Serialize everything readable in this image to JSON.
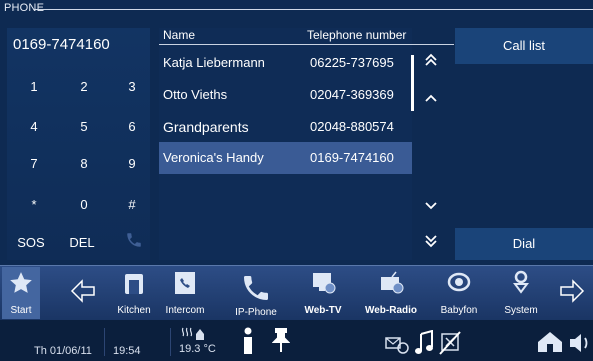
{
  "screen": {
    "title": "PHONE"
  },
  "keypad": {
    "number": "0169-7474160",
    "keys": [
      "1",
      "2",
      "3",
      "4",
      "5",
      "6",
      "7",
      "8",
      "9",
      "*",
      "0",
      "#"
    ],
    "sos_label": "SOS",
    "del_label": "DEL"
  },
  "contacts": {
    "col_name": "Name",
    "col_phone": "Telephone number",
    "rows": [
      {
        "name": "Katja Liebermann",
        "phone": "06225-737695"
      },
      {
        "name": "Otto Vieths",
        "phone": "02047-369369"
      },
      {
        "name": "Grandparents",
        "phone": "02048-880574"
      },
      {
        "name": "Veronica's Handy",
        "phone": "0169-7474160"
      }
    ],
    "selected_index": 3
  },
  "actions": {
    "call_list": "Call list",
    "dial": "Dial"
  },
  "dock": {
    "start": "Start",
    "kitchen": "Kitchen",
    "intercom": "Intercom",
    "ip_phone": "IP-Phone",
    "web_tv": "Web-TV",
    "web_radio": "Web-Radio",
    "babyfon": "Babyfon",
    "system": "System"
  },
  "status": {
    "date": "Th 01/06/11",
    "time": "19:54",
    "temperature": "19.3 °C"
  },
  "colors": {
    "background": "#0e2a52",
    "selected_row": "#3a5b95",
    "button": "#1a4479",
    "dock": "#2d4d86",
    "call_icon_disabled": "#3f5f95"
  }
}
